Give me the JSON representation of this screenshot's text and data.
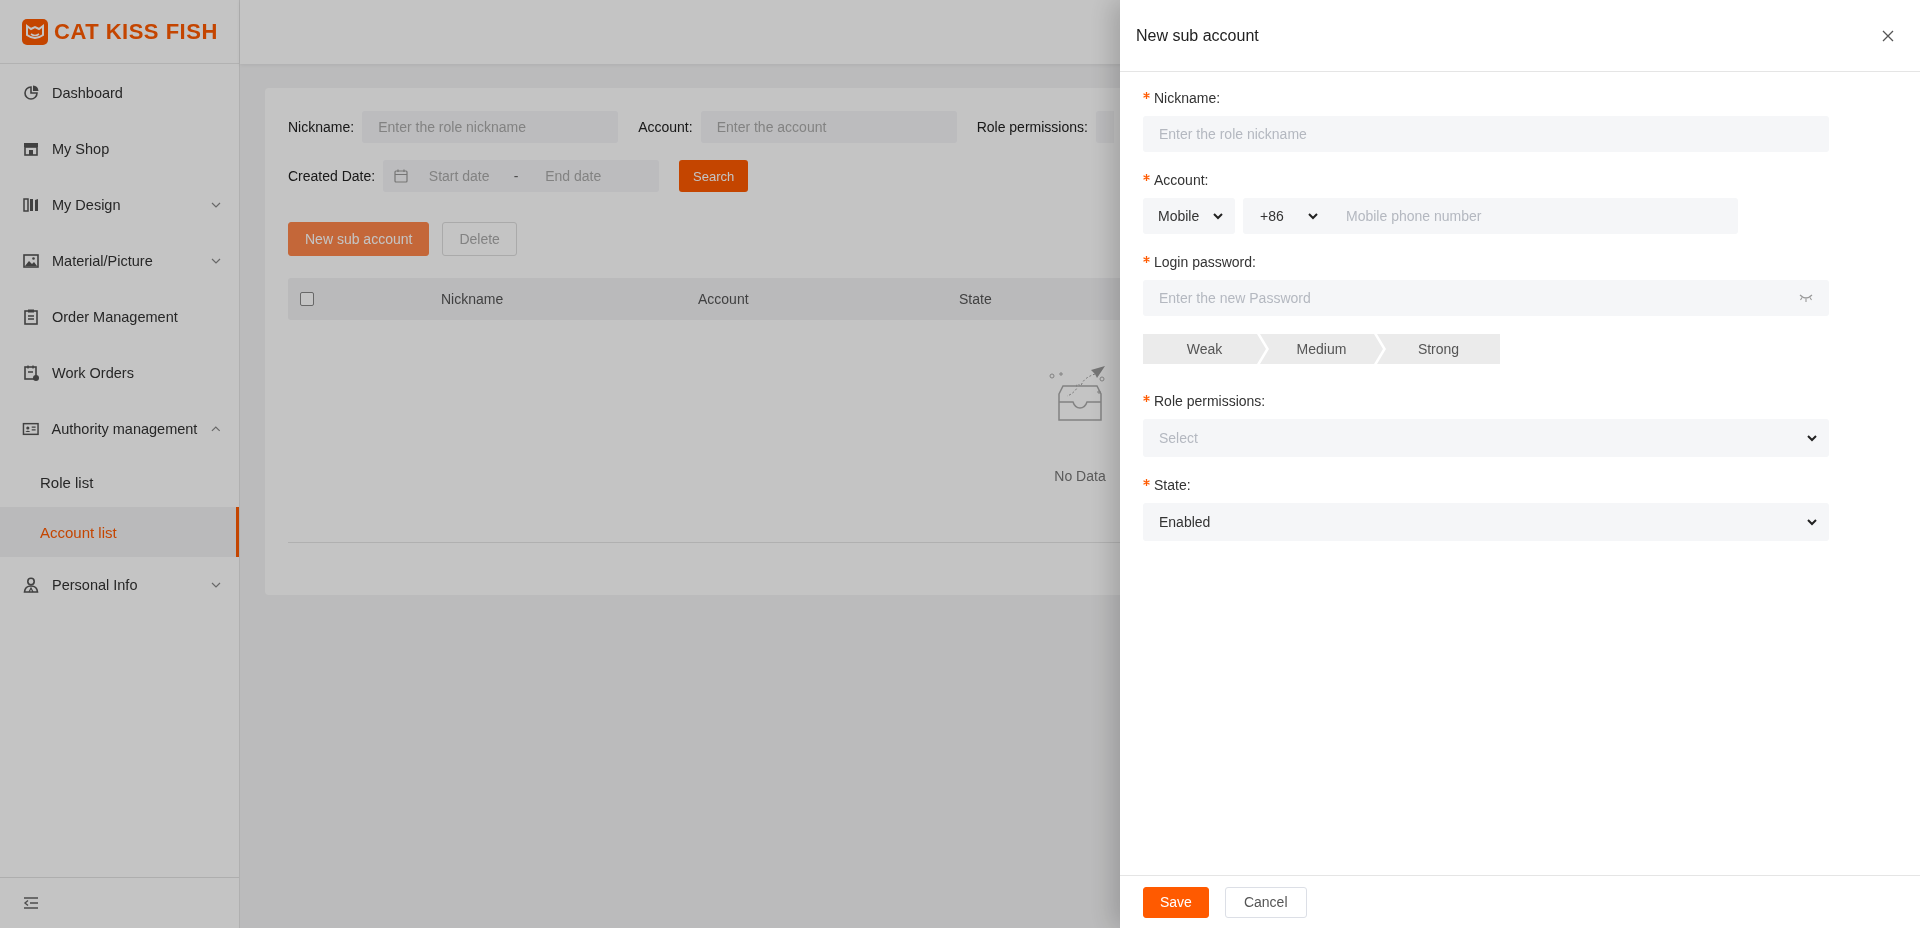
{
  "sidebar": {
    "logo": "CAT KISS FISH",
    "items": [
      {
        "label": "Dashboard"
      },
      {
        "label": "My Shop"
      },
      {
        "label": "My Design",
        "expanded": false
      },
      {
        "label": "Material/Picture",
        "expanded": false
      },
      {
        "label": "Order Management"
      },
      {
        "label": "Work Orders"
      },
      {
        "label": "Authority management",
        "expanded": true,
        "children": [
          {
            "label": "Role list",
            "selected": false
          },
          {
            "label": "Account list",
            "selected": true
          }
        ]
      },
      {
        "label": "Personal Info",
        "expanded": false
      }
    ]
  },
  "filters": {
    "fields": [
      {
        "kind": "text",
        "label": "Nickname:",
        "placeholder": "Enter the role nickname"
      },
      {
        "kind": "text",
        "label": "Account:",
        "placeholder": "Enter the account"
      },
      {
        "kind": "select",
        "label": "Role permissions:"
      }
    ],
    "date": {
      "label": "Created Date:",
      "start_placeholder": "Start date",
      "separator": "-",
      "end_placeholder": "End date"
    },
    "search_button": "Search"
  },
  "actions": [
    {
      "label": "New sub account",
      "disabled": false
    },
    {
      "label": "Delete",
      "disabled": true
    }
  ],
  "table": {
    "select_all_checked": false,
    "columns": [
      "Nickname",
      "Account",
      "State"
    ],
    "empty_text": "No Data"
  },
  "drawer": {
    "title": "New sub account",
    "fields": [
      {
        "kind": "text",
        "label": "Nickname:",
        "required": true,
        "placeholder": "Enter the role nickname"
      },
      {
        "kind": "phone",
        "label": "Account:",
        "required": true,
        "account_type": "Mobile",
        "country_code": "+86",
        "placeholder": "Mobile phone number"
      },
      {
        "kind": "password",
        "label": "Login password:",
        "required": true,
        "placeholder": "Enter the new Password",
        "strength_levels": [
          "Weak",
          "Medium",
          "Strong"
        ]
      },
      {
        "kind": "select",
        "label": "Role permissions:",
        "required": true,
        "placeholder": "Select"
      },
      {
        "kind": "select",
        "label": "State:",
        "required": true,
        "value": "Enabled"
      }
    ],
    "buttons": [
      {
        "label": "Save",
        "kind": "primary"
      },
      {
        "label": "Cancel",
        "kind": "default"
      }
    ]
  }
}
